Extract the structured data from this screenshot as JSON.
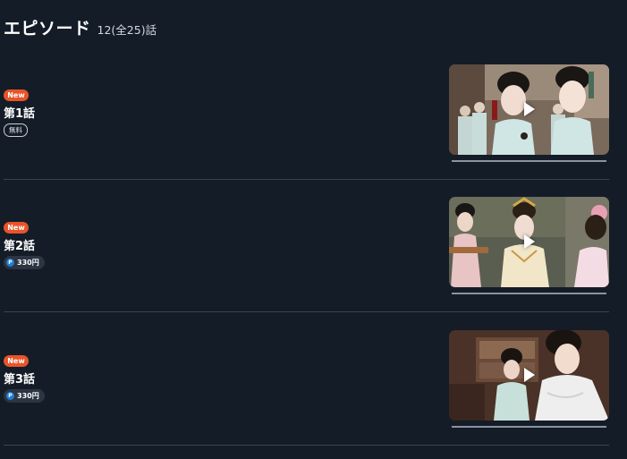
{
  "header": {
    "title": "エピソード",
    "count": "12(全25)話"
  },
  "episodes": [
    {
      "new_label": "New",
      "title": "第1話",
      "price_type": "free",
      "free_label": "無料",
      "price_label": "",
      "point_icon": "P"
    },
    {
      "new_label": "New",
      "title": "第2話",
      "price_type": "paid",
      "free_label": "",
      "price_label": "330円",
      "point_icon": "P"
    },
    {
      "new_label": "New",
      "title": "第3話",
      "price_type": "paid",
      "free_label": "",
      "price_label": "330円",
      "point_icon": "P"
    }
  ],
  "icons": {
    "play": "play-icon",
    "point": "point-icon"
  },
  "colors": {
    "background": "#141c28",
    "new_badge": "#e8542a",
    "point_icon": "#1f7fd6",
    "divider": "#3a4350"
  }
}
